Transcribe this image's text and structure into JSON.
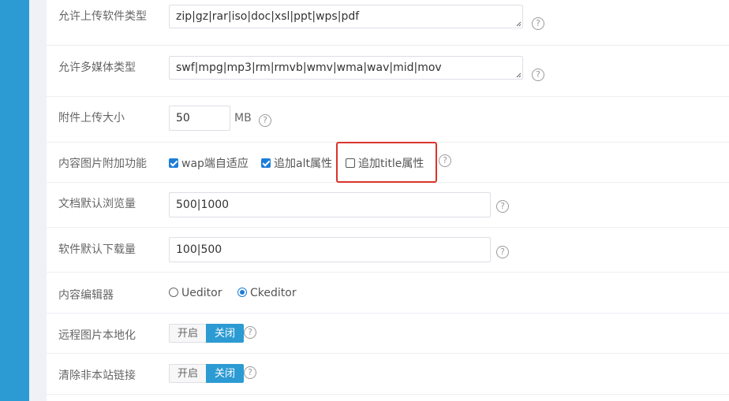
{
  "colors": {
    "sidebar": "#2c9bd3",
    "accent": "#1d7dd8",
    "highlight": "#d9342b"
  },
  "help_icon": "question-circle-icon",
  "upload_types": {
    "label": "允许上传软件类型",
    "value": "zip|gz|rar|iso|doc|xsl|ppt|wps|pdf"
  },
  "media_types": {
    "label": "允许多媒体类型",
    "value": "swf|mpg|mp3|rm|rmvb|wmv|wma|wav|mid|mov"
  },
  "attachment_size": {
    "label": "附件上传大小",
    "value": "50",
    "unit": "MB"
  },
  "image_features": {
    "label": "内容图片附加功能",
    "options": [
      {
        "label": "wap端自适应",
        "checked": true
      },
      {
        "label": "追加alt属性",
        "checked": true
      },
      {
        "label": "追加title属性",
        "checked": false
      }
    ]
  },
  "doc_views": {
    "label": "文档默认浏览量",
    "value": "500|1000"
  },
  "soft_downloads": {
    "label": "软件默认下载量",
    "value": "100|500"
  },
  "editor": {
    "label": "内容编辑器",
    "options": [
      {
        "label": "Ueditor",
        "selected": false
      },
      {
        "label": "Ckeditor",
        "selected": true
      }
    ]
  },
  "remote_image": {
    "label": "远程图片本地化",
    "on_label": "开启",
    "off_label": "关闭",
    "active": "关闭"
  },
  "clear_links": {
    "label": "清除非本站链接",
    "on_label": "开启",
    "off_label": "关闭",
    "active": "关闭"
  }
}
